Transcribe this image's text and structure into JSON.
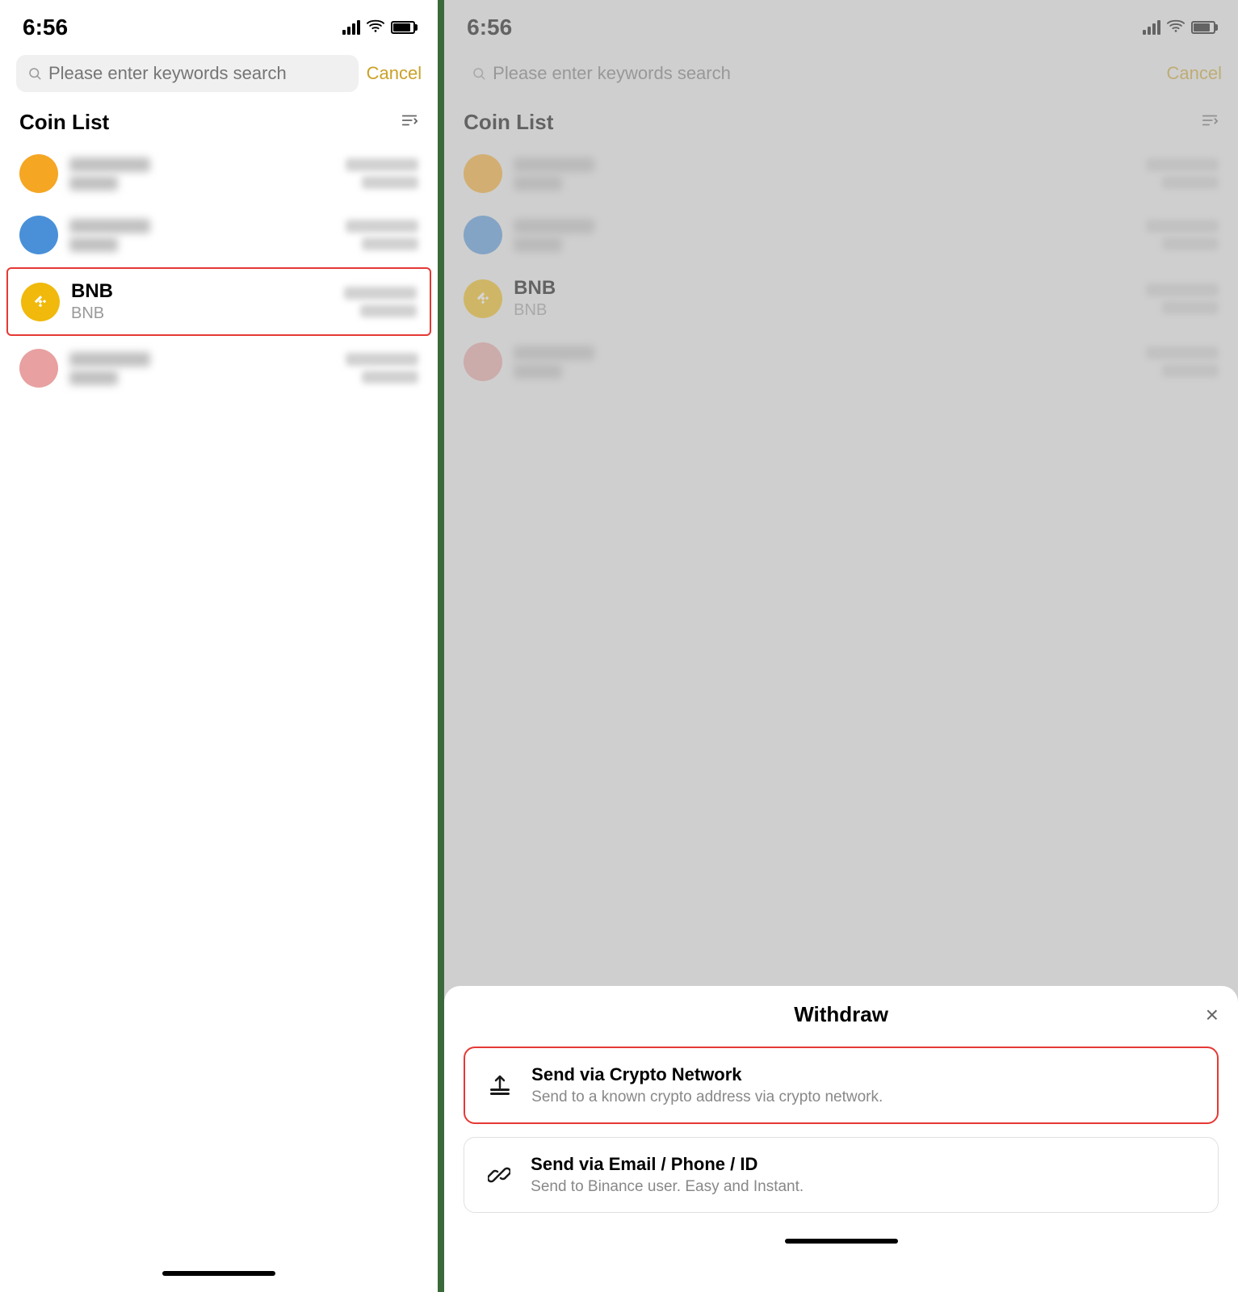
{
  "left": {
    "statusBar": {
      "time": "6:56"
    },
    "searchBar": {
      "placeholder": "Please enter keywords search",
      "cancelLabel": "Cancel"
    },
    "coinList": {
      "title": "Coin List",
      "sortIconLabel": "↓A-Z",
      "items": [
        {
          "id": "coin1",
          "avatarColor": "orange",
          "highlighted": false,
          "showBnb": false
        },
        {
          "id": "coin2",
          "avatarColor": "blue",
          "highlighted": false,
          "showBnb": false
        },
        {
          "id": "bnb",
          "name": "BNB",
          "sub": "BNB",
          "avatarColor": "bnb",
          "highlighted": true,
          "showBnb": true
        },
        {
          "id": "coin4",
          "avatarColor": "pink",
          "highlighted": false,
          "showBnb": false
        }
      ]
    },
    "homeBar": {}
  },
  "right": {
    "statusBar": {
      "time": "6:56"
    },
    "searchBar": {
      "placeholder": "Please enter keywords search",
      "cancelLabel": "Cancel"
    },
    "coinList": {
      "title": "Coin List",
      "sortIconLabel": "↓A-Z",
      "items": [
        {
          "id": "coin1",
          "avatarColor": "orange",
          "highlighted": false,
          "showBnb": false
        },
        {
          "id": "coin2",
          "avatarColor": "blue",
          "highlighted": false,
          "showBnb": false
        },
        {
          "id": "bnb",
          "name": "BNB",
          "sub": "BNB",
          "avatarColor": "bnb",
          "highlighted": false,
          "showBnb": true
        },
        {
          "id": "coin4",
          "avatarColor": "pink",
          "highlighted": false,
          "showBnb": false
        }
      ]
    },
    "bottomSheet": {
      "title": "Withdraw",
      "closeLabel": "×",
      "options": [
        {
          "id": "crypto",
          "highlighted": true,
          "title": "Send via Crypto Network",
          "description": "Send to a known crypto address via crypto network.",
          "iconType": "upload"
        },
        {
          "id": "email",
          "highlighted": false,
          "title": "Send via Email / Phone / ID",
          "description": "Send to Binance user. Easy and Instant.",
          "iconType": "link"
        }
      ]
    },
    "homeBar": {}
  }
}
